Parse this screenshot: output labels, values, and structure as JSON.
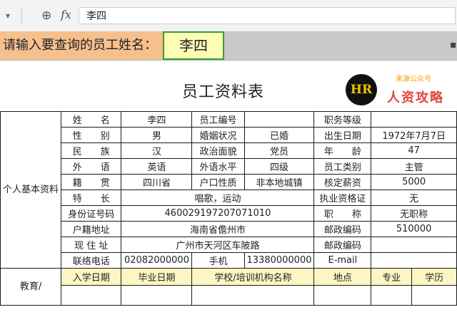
{
  "formula_bar": {
    "fx": "fx",
    "value": "李四"
  },
  "query": {
    "label": "请输入要查询的员工姓名：",
    "value": "李四"
  },
  "sheet": {
    "title": "员工资料表"
  },
  "logo": {
    "mark": "HR",
    "source": "来源公众号",
    "name": "人资攻略"
  },
  "section_personal": "个人基本资料",
  "section_edu": "教育/",
  "rows": [
    [
      "姓　　名",
      "李四",
      "员工编号",
      "",
      "职务等级",
      ""
    ],
    [
      "性　　别",
      "男",
      "婚姻状况",
      "已婚",
      "出生日期",
      "1972年7月7日"
    ],
    [
      "民　　族",
      "汉",
      "政治面貌",
      "党员",
      "年　　龄",
      "47"
    ],
    [
      "外　　语",
      "英语",
      "外语水平",
      "四级",
      "员工类别",
      "主管"
    ],
    [
      "籍　　贯",
      "四川省",
      "户口性质",
      "非本地城镇",
      "核定薪资",
      "5000"
    ]
  ],
  "r6": {
    "k1": "特　　长",
    "v1": "唱歌，运动",
    "k2": "执业资格证",
    "v2": "无"
  },
  "r7": {
    "k1": "身份证号码",
    "v1": "460029197207071010",
    "k2": "职　　称",
    "v2": "无职称"
  },
  "r8": {
    "k1": "户籍地址",
    "v1": "海南省儋州市",
    "k2": "邮政编码",
    "v2": "510000"
  },
  "r9": {
    "k1": "现 住 址",
    "v1": "广州市天河区车陂路",
    "k2": "邮政编码",
    "v2": ""
  },
  "r10": {
    "k1": "联络电话",
    "v1": "02082000000",
    "k2": "手机",
    "v2": "13380000000",
    "k3": "E-mail",
    "v3": ""
  },
  "edu_headers": [
    "入学日期",
    "毕业日期",
    "学校/培训机构名称",
    "地点",
    "专业",
    "学历"
  ]
}
